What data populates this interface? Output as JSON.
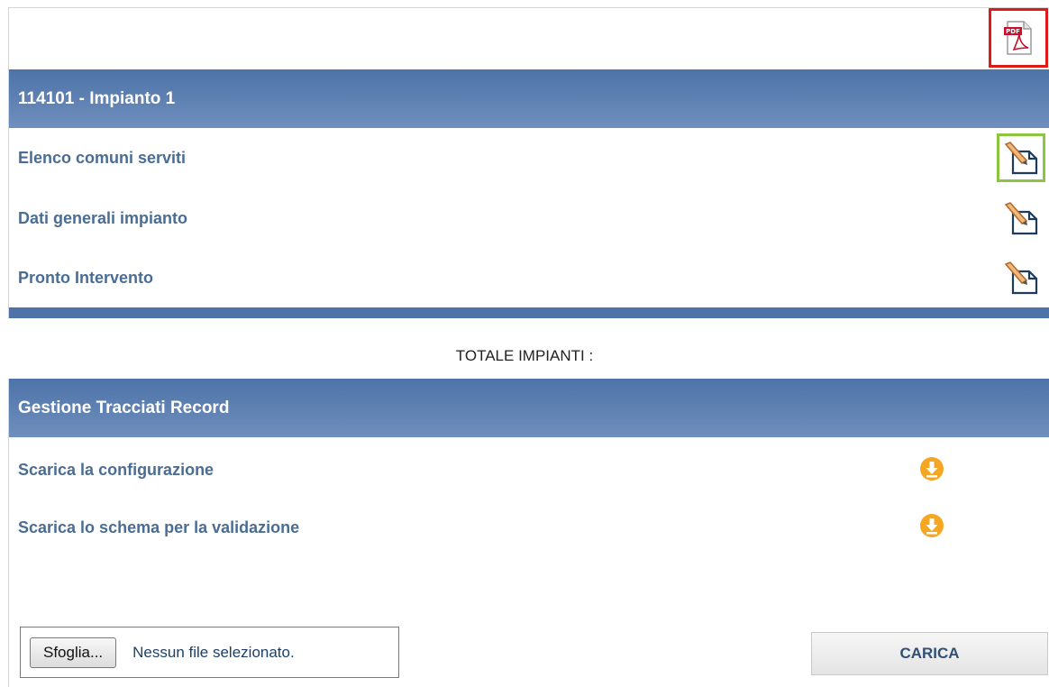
{
  "section_impianto": {
    "header": "114101 - Impianto 1",
    "rows": [
      {
        "label": "Elenco comuni serviti",
        "icon": "edit-document-icon"
      },
      {
        "label": "Dati generali impianto",
        "icon": "edit-document-icon"
      },
      {
        "label": "Pronto Intervento",
        "icon": "edit-document-icon"
      }
    ],
    "export_icon": "pdf-icon"
  },
  "totale_label": "TOTALE IMPIANTI :",
  "section_tracciati": {
    "header": "Gestione Tracciati Record",
    "rows": [
      {
        "label": "Scarica la configurazione",
        "icon": "download-icon"
      },
      {
        "label": "Scarica lo schema per la validazione",
        "icon": "download-icon"
      }
    ]
  },
  "upload": {
    "browse_label": "Sfoglia...",
    "file_status": "Nessun file selezionato.",
    "submit_label": "CARICA"
  },
  "colors": {
    "header_bg": "#4d73a8",
    "link_text": "#4a6d96",
    "download_orange": "#f5a623",
    "pdf_highlight": "#e01919",
    "edit_highlight": "#8cc63f"
  }
}
